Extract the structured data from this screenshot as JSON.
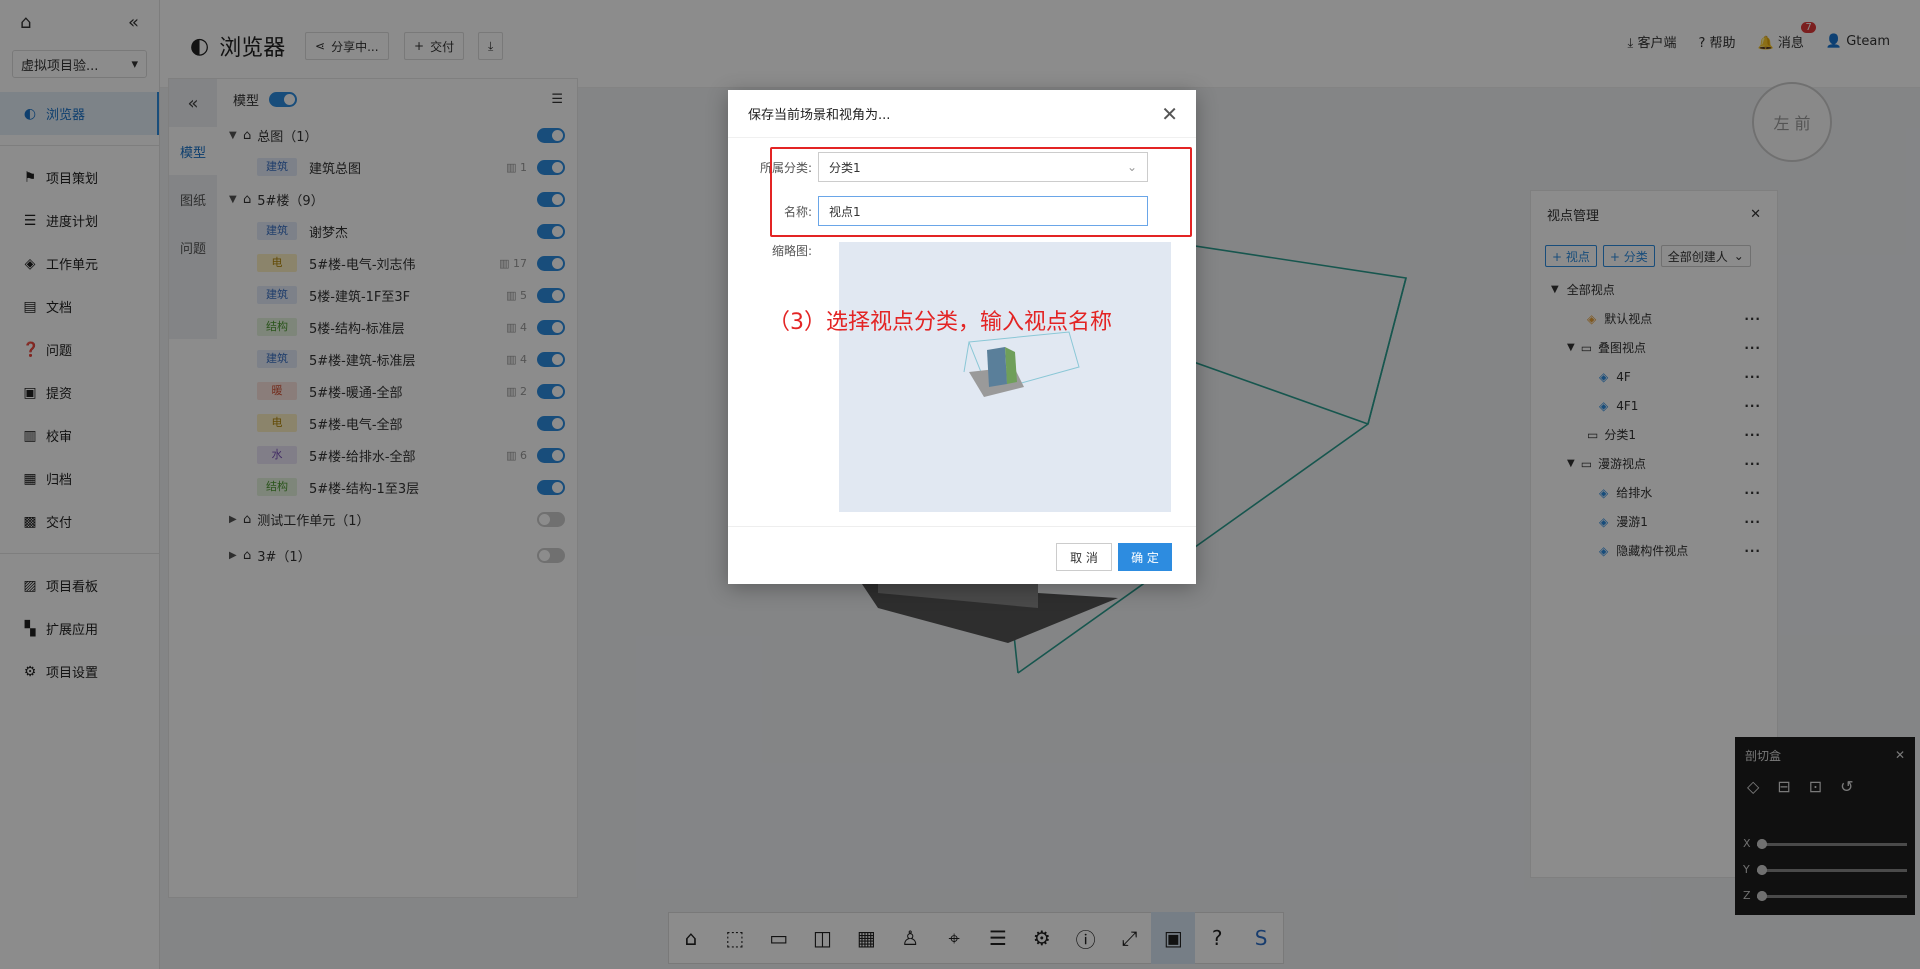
{
  "nav": {
    "project": "虚拟项目验...",
    "items": [
      {
        "label": "浏览器",
        "icon": "globe-icon",
        "active": true
      },
      {
        "label": "项目策划",
        "icon": "flag-icon"
      },
      {
        "label": "进度计划",
        "icon": "timeline-icon"
      },
      {
        "label": "工作单元",
        "icon": "cube-icon"
      },
      {
        "label": "文档",
        "icon": "document-icon"
      },
      {
        "label": "问题",
        "icon": "question-icon"
      },
      {
        "label": "提资",
        "icon": "upload-doc-icon"
      },
      {
        "label": "校审",
        "icon": "review-icon"
      },
      {
        "label": "归档",
        "icon": "archive-icon"
      },
      {
        "label": "交付",
        "icon": "briefcase-icon"
      },
      {
        "label": "项目看板",
        "icon": "dashboard-icon"
      },
      {
        "label": "扩展应用",
        "icon": "apps-icon"
      },
      {
        "label": "项目设置",
        "icon": "gear-icon"
      }
    ]
  },
  "header": {
    "title": "浏览器",
    "share": "分享中...",
    "deliver": "交付",
    "client": "客户端",
    "help": "帮助",
    "messages": "消息",
    "message_count": "7",
    "user": "Gteam"
  },
  "model_panel": {
    "tabs": [
      "模型",
      "图纸",
      "问题"
    ],
    "header": "模型",
    "groups": [
      {
        "label": "总图（1）",
        "children": [
          {
            "tag": "建筑",
            "tagColor": "blue",
            "label": "建筑总图",
            "count": "1"
          }
        ],
        "on": true
      },
      {
        "label": "5#楼（9）",
        "on": true,
        "children": [
          {
            "tag": "建筑",
            "tagColor": "blue",
            "label": "谢梦杰",
            "count": ""
          },
          {
            "tag": "电",
            "tagColor": "yellow",
            "label": "5#楼-电气-刘志伟",
            "count": "17"
          },
          {
            "tag": "建筑",
            "tagColor": "blue",
            "label": "5楼-建筑-1F至3F",
            "count": "5"
          },
          {
            "tag": "结构",
            "tagColor": "green",
            "label": "5楼-结构-标准层",
            "count": "4"
          },
          {
            "tag": "建筑",
            "tagColor": "blue",
            "label": "5#楼-建筑-标准层",
            "count": "4"
          },
          {
            "tag": "暖",
            "tagColor": "red",
            "label": "5#楼-暖通-全部",
            "count": "2"
          },
          {
            "tag": "电",
            "tagColor": "yellow",
            "label": "5#楼-电气-全部",
            "count": ""
          },
          {
            "tag": "水",
            "tagColor": "purple",
            "label": "5#楼-给排水-全部",
            "count": "6"
          },
          {
            "tag": "结构",
            "tagColor": "green",
            "label": "5#楼-结构-1至3层",
            "count": ""
          }
        ]
      },
      {
        "label": "测试工作单元（1）",
        "on": false,
        "children": []
      },
      {
        "label": "3#（1）",
        "on": false,
        "children": []
      }
    ]
  },
  "viewpoints": {
    "title": "视点管理",
    "add_view": "+ 视点",
    "add_category": "+ 分类",
    "creator_filter": "全部创建人",
    "tree": [
      {
        "label": "全部视点",
        "level": 0,
        "type": "root"
      },
      {
        "label": "默认视点",
        "level": 2,
        "type": "default"
      },
      {
        "label": "叠图视点",
        "level": 1,
        "type": "folder"
      },
      {
        "label": "4F",
        "level": 2,
        "type": "view"
      },
      {
        "label": "4F1",
        "level": 2,
        "type": "view"
      },
      {
        "label": "分类1",
        "level": 1,
        "type": "folder-closed"
      },
      {
        "label": "漫游视点",
        "level": 1,
        "type": "folder"
      },
      {
        "label": "给排水",
        "level": 2,
        "type": "view"
      },
      {
        "label": "漫游1",
        "level": 2,
        "type": "view"
      },
      {
        "label": "隐藏构件视点",
        "level": 2,
        "type": "view"
      }
    ]
  },
  "section_box": {
    "title": "剖切盒",
    "axes": [
      "X",
      "Y",
      "Z"
    ]
  },
  "viewcube": {
    "left": "左",
    "front": "前"
  },
  "modal": {
    "title": "保存当前场景和视角为...",
    "category_label": "所属分类:",
    "category_value": "分类1",
    "name_label": "名称:",
    "name_value": "视点1",
    "thumb_label": "缩略图:",
    "annotation": "（3）选择视点分类，输入视点名称",
    "cancel": "取 消",
    "ok": "确 定"
  }
}
